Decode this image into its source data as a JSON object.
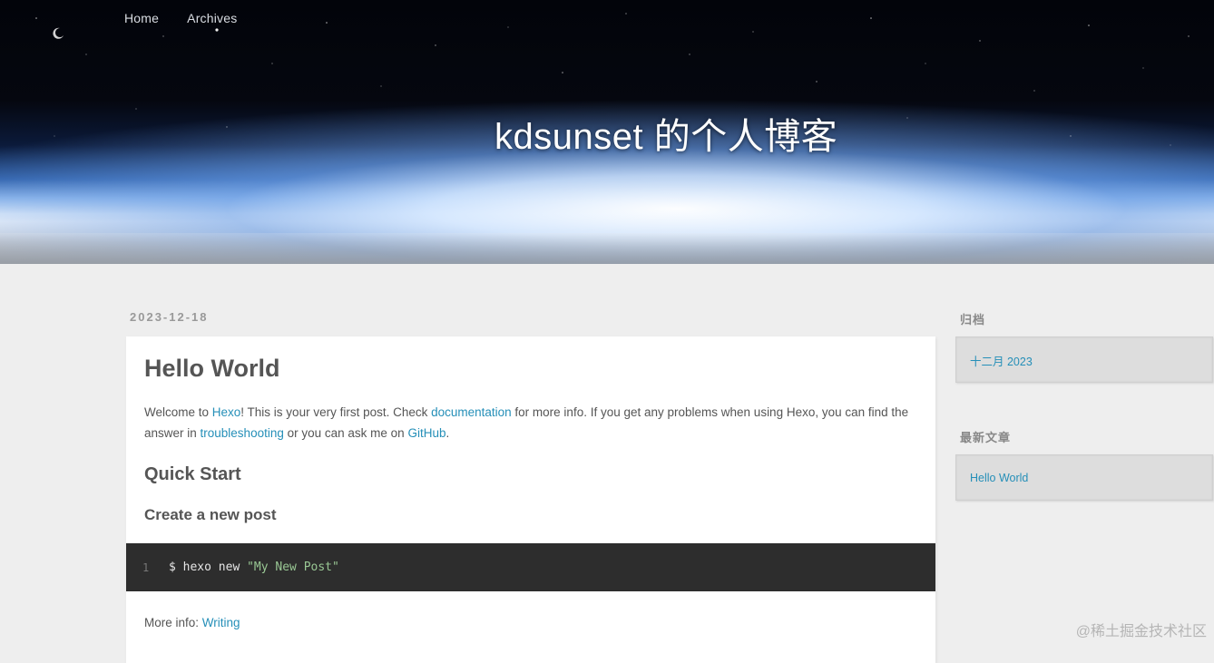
{
  "nav": {
    "items": [
      {
        "label": "Home"
      },
      {
        "label": "Archives"
      }
    ]
  },
  "site": {
    "title": "kdsunset 的个人博客"
  },
  "post": {
    "date": "2023-12-18",
    "title": "Hello World",
    "intro": {
      "t1": "Welcome to ",
      "link_hexo": "Hexo",
      "t2": "! This is your very first post. Check ",
      "link_docs": "documentation",
      "t3": " for more info. If you get any problems when using Hexo, you can find the answer in ",
      "link_trouble": "troubleshooting",
      "t4": " or you can ask me on ",
      "link_github": "GitHub",
      "t5": "."
    },
    "heading_quick_start": "Quick Start",
    "heading_create_post": "Create a new post",
    "code": {
      "line_number": "1",
      "command": "$ hexo new ",
      "string": "\"My New Post\""
    },
    "more_info": {
      "label": "More info: ",
      "link": "Writing"
    }
  },
  "sidebar": {
    "archive_title": "归档",
    "archive_item": "十二月 2023",
    "recent_title": "最新文章",
    "recent_item": "Hello World"
  },
  "watermark": "@稀土掘金技术社区",
  "colors": {
    "link": "#258fb8",
    "page_background": "#eeeeee",
    "code_background": "#2d2d2d"
  }
}
